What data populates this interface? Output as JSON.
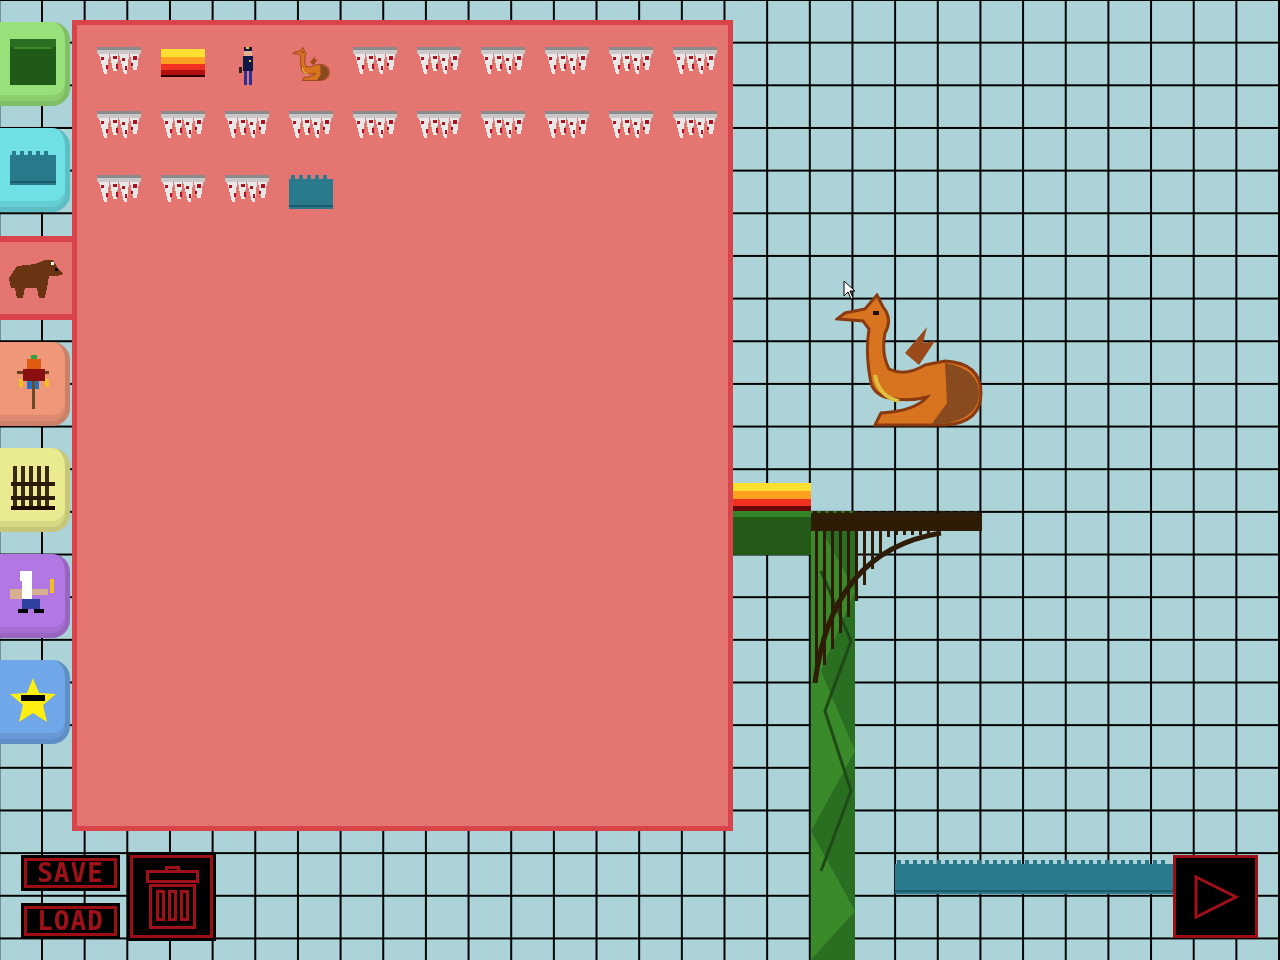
{
  "categories": [
    {
      "kind": "terrain",
      "color": "#97e07a",
      "selected": false
    },
    {
      "kind": "water",
      "color": "#6ee0e6",
      "selected": false
    },
    {
      "kind": "animal",
      "color": "#e57570",
      "selected": true
    },
    {
      "kind": "monster",
      "color": "#f0977a",
      "selected": false
    },
    {
      "kind": "structure",
      "color": "#eaea90",
      "selected": false
    },
    {
      "kind": "wizard",
      "color": "#b377e3",
      "selected": false
    },
    {
      "kind": "star",
      "color": "#6fa7e8",
      "selected": false
    }
  ],
  "palette": {
    "items": [
      {
        "kind": "spikes"
      },
      {
        "kind": "lava"
      },
      {
        "kind": "guard"
      },
      {
        "kind": "dragon"
      },
      {
        "kind": "spikes"
      },
      {
        "kind": "spikes"
      },
      {
        "kind": "spikes"
      },
      {
        "kind": "spikes"
      },
      {
        "kind": "spikes"
      },
      {
        "kind": "spikes"
      },
      {
        "kind": "spikes"
      },
      {
        "kind": "spikes"
      },
      {
        "kind": "spikes"
      },
      {
        "kind": "spikes"
      },
      {
        "kind": "spikes"
      },
      {
        "kind": "spikes"
      },
      {
        "kind": "spikes"
      },
      {
        "kind": "spikes"
      },
      {
        "kind": "spikes"
      },
      {
        "kind": "spikes"
      },
      {
        "kind": "spikes"
      },
      {
        "kind": "spikes"
      },
      {
        "kind": "spikes"
      },
      {
        "kind": "water"
      }
    ]
  },
  "buttons": {
    "save": "SAVE",
    "load": "LOAD"
  }
}
